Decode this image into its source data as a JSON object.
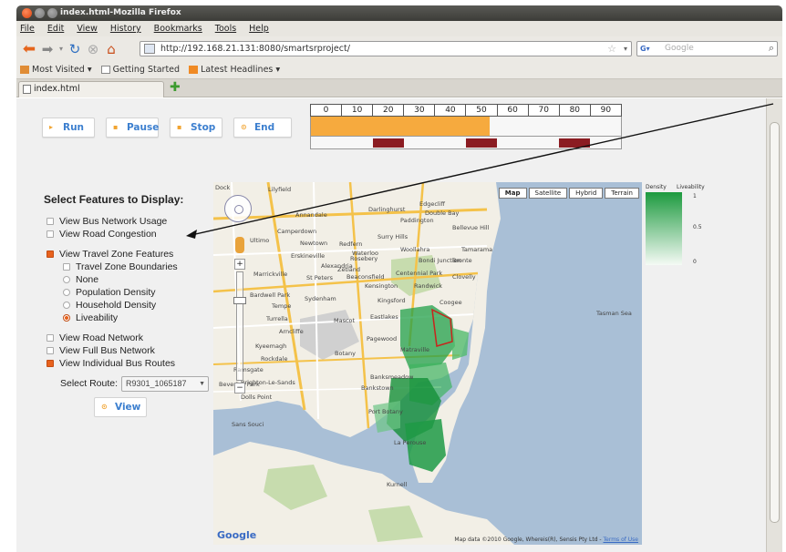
{
  "window": {
    "title": "index.html-Mozilla Firefox",
    "menu": [
      "File",
      "Edit",
      "View",
      "History",
      "Bookmarks",
      "Tools",
      "Help"
    ]
  },
  "toolbar": {
    "url": "http://192.168.21.131:8080/smartsrproject/",
    "search_placeholder": "Google"
  },
  "bookmarks": [
    "Most Visited ▾",
    "Getting Started",
    "Latest Headlines ▾"
  ],
  "tab": {
    "title": "index.html"
  },
  "controls": {
    "buttons": [
      {
        "label": "Run",
        "icon": "run-icon"
      },
      {
        "label": "Pause",
        "icon": "pause-icon"
      },
      {
        "label": "Stop",
        "icon": "stop-icon"
      },
      {
        "label": "End",
        "icon": "end-icon"
      }
    ]
  },
  "timeline": {
    "ticks": [
      "0",
      "10",
      "20",
      "30",
      "40",
      "50",
      "60",
      "70",
      "80",
      "90"
    ],
    "progress_fraction": 0.575,
    "events": [
      {
        "start_fraction": 0.2,
        "end_fraction": 0.3
      },
      {
        "start_fraction": 0.5,
        "end_fraction": 0.6
      },
      {
        "start_fraction": 0.8,
        "end_fraction": 0.9
      }
    ],
    "colors": {
      "progress": "#f6aa3e",
      "event": "#8b1c22"
    }
  },
  "features": {
    "title": "Select Features to Display:",
    "group1": [
      {
        "label": "View Bus Network Usage",
        "checked": false
      },
      {
        "label": "View Road Congestion",
        "checked": false
      }
    ],
    "travel_zone": {
      "label": "View Travel Zone Features",
      "checked": true
    },
    "travel_zone_boundaries": {
      "label": "Travel Zone Boundaries",
      "checked": false
    },
    "travel_zone_radios": [
      {
        "label": "None",
        "selected": false
      },
      {
        "label": "Population Density",
        "selected": false
      },
      {
        "label": "Household Density",
        "selected": false
      },
      {
        "label": "Liveability",
        "selected": true
      }
    ],
    "group3": [
      {
        "label": "View Road Network",
        "checked": false
      },
      {
        "label": "View Full Bus Network",
        "checked": false
      },
      {
        "label": "View Individual Bus Routes",
        "checked": true
      }
    ],
    "route_label": "Select Route:",
    "route_value": "R9301_1065187",
    "view_button": "View"
  },
  "map": {
    "types": [
      "Map",
      "Satellite",
      "Hybrid",
      "Terrain"
    ],
    "active_type": "Map",
    "places": [
      "Dock",
      "Lilyfield",
      "Annandale",
      "Camperdown",
      "Newtown",
      "Erskineville",
      "St Peters",
      "Zetland",
      "Marrickville",
      "Tempe",
      "Mascot",
      "Botany",
      "Paddington",
      "Darlinghurst",
      "Surry Hills",
      "Randwick",
      "Kingsford",
      "Coogee",
      "Bronte",
      "Tamarama",
      "Clovelly",
      "Eastlakes",
      "Pagewood",
      "Matraville",
      "Bankstown",
      "Banksmeadow",
      "Port Botany",
      "La Perouse",
      "Kurnell",
      "Dolls Point",
      "Sans Souci",
      "Beverley Park",
      "Ramsgate",
      "Brighton-Le-Sands",
      "Kyeemagh",
      "Rockdale",
      "Tasman Sea",
      "Woollahra",
      "Bondi Junction",
      "Centennial Park",
      "Kensington",
      "Rosebery",
      "Redfern",
      "Waterloo",
      "Alexandria",
      "Beaconsfield",
      "Sydenham",
      "Arncliffe",
      "Turrella",
      "Bardwell Park",
      "Edgecliff",
      "Double Bay",
      "Bellevue Hill",
      "Ultimo"
    ],
    "logo": "Google",
    "attribution": "Map data ©2010 Google, Whereis(R), Sensis Pty Ltd -",
    "attribution_link": "Terms of Use"
  },
  "legend": {
    "headers": [
      "Density",
      "Liveability"
    ],
    "values": [
      "1",
      "0.5",
      "0"
    ],
    "colors": {
      "high": "#1d9a3f",
      "low": "#f5faf5"
    }
  },
  "colors": {
    "accent": "#3c7fcf",
    "checked": "#e8621d"
  }
}
